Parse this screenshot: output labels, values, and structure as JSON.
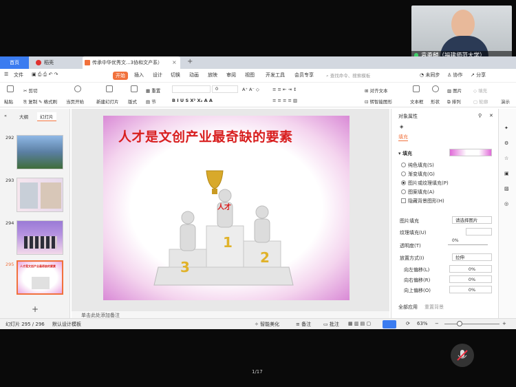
{
  "webcam": {
    "name": "袁勇麟（福建师范大学）"
  },
  "tabs": {
    "home": "首页",
    "daoke": "稻壳",
    "doc": "传承中华优秀文...3协和文产系）"
  },
  "menu": {
    "file": "文件",
    "start": "开始",
    "items": [
      "插入",
      "设计",
      "切换",
      "动画",
      "放映",
      "审阅",
      "视图",
      "开发工具",
      "会员专享"
    ],
    "search": "查找命令、搜索模板",
    "unsync": "未同步",
    "collab": "协作",
    "share": "分享"
  },
  "toolbar": {
    "paste": "粘贴",
    "cut": "剪切",
    "copy": "复制",
    "format_painter": "格式刷",
    "from_current": "当页开始",
    "new_slide": "新建幻灯片",
    "layout": "版式",
    "section": "节",
    "reset": "重置",
    "font_size": "0",
    "align_text": "对齐文本",
    "convert_smartart": "转智能图形",
    "textbox": "文本框",
    "shape": "形状",
    "arrange": "排列",
    "picture": "图片",
    "fill": "填充",
    "outline": "轮廓",
    "presentation": "演示"
  },
  "leftpanel": {
    "tab_outline": "大纲",
    "tab_slides": "幻灯片",
    "thumbs": [
      "292",
      "293",
      "294",
      "295"
    ]
  },
  "slide": {
    "title": "人才是文创产业最奇缺的要素",
    "figure_label": "人才",
    "place1": "1",
    "place2": "2",
    "place3": "3"
  },
  "notes": "单击此处添加备注",
  "props": {
    "title": "对象属性",
    "tab_fill": "填充",
    "section_fill": "填充",
    "options": [
      "纯色填充(S)",
      "渐变填充(G)",
      "图片或纹理填充(P)",
      "图案填充(A)"
    ],
    "selected_option": 2,
    "hide_bg": "隐藏背景图形(H)",
    "picture_fill": "图片填充",
    "picture_fill_value": "请选择图片",
    "texture_fill": "纹理填充(U)",
    "transparency": "透明度(T)",
    "transparency_value": "0%",
    "placement": "放置方式(I)",
    "placement_value": "拉伸",
    "left_offset": "向左偏移(L)",
    "left_value": "0%",
    "right_offset": "向右偏移(R)",
    "right_value": "0%",
    "up_offset": "向上偏移(O)",
    "up_value": "0%",
    "apply_all": "全部应用",
    "reset_bg": "重置背景"
  },
  "status": {
    "slide_count": "幻灯片 295 / 296",
    "template": "默认设计模板",
    "beautify": "智能美化",
    "notes": "备注",
    "comments": "批注",
    "zoom": "63%"
  },
  "pager": "1/17",
  "colors": {
    "accent": "#3b7cf0",
    "start": "#f1713c",
    "title": "#d81e1e"
  }
}
